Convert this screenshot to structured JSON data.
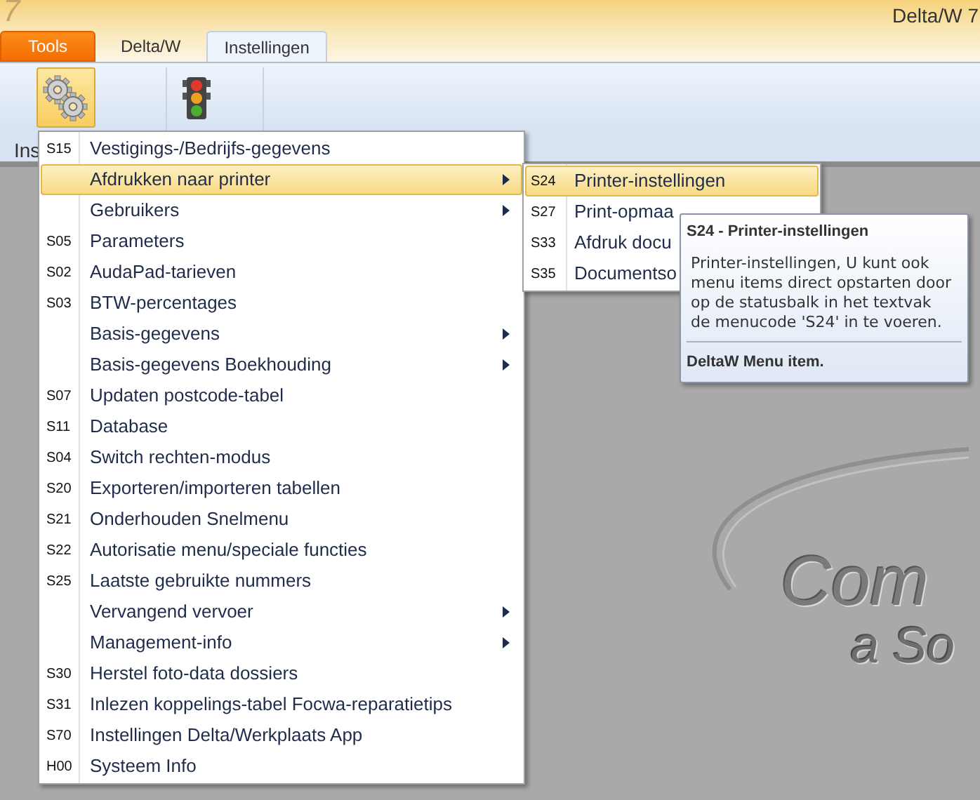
{
  "window": {
    "app_mark": "7",
    "title": "Delta/W 7"
  },
  "tabs": [
    {
      "label": "Tools",
      "selected": true
    },
    {
      "label": "Delta/W",
      "selected": false
    },
    {
      "label": "Instellingen",
      "selected": false
    }
  ],
  "ribbon": {
    "buttons": [
      {
        "kind": "gears",
        "selected": true
      },
      {
        "kind": "traffic-light",
        "selected": false
      }
    ],
    "group_label": "Ins"
  },
  "menu": {
    "items": [
      {
        "code": "S15",
        "label": "Vestigings-/Bedrijfs-gegevens",
        "submenu": false,
        "selected": false
      },
      {
        "label": "Afdrukken naar printer",
        "submenu": true,
        "selected": true
      },
      {
        "label": "Gebruikers",
        "submenu": true,
        "selected": false
      },
      {
        "code": "S05",
        "label": "Parameters",
        "submenu": false,
        "selected": false
      },
      {
        "code": "S02",
        "label": "AudaPad-tarieven",
        "submenu": false,
        "selected": false
      },
      {
        "code": "S03",
        "label": "BTW-percentages",
        "submenu": false,
        "selected": false
      },
      {
        "label": "Basis-gegevens",
        "submenu": true,
        "selected": false
      },
      {
        "label": "Basis-gegevens Boekhouding",
        "submenu": true,
        "selected": false
      },
      {
        "code": "S07",
        "label": "Updaten postcode-tabel",
        "submenu": false,
        "selected": false
      },
      {
        "code": "S11",
        "label": "Database",
        "submenu": false,
        "selected": false
      },
      {
        "code": "S04",
        "label": "Switch rechten-modus",
        "submenu": false,
        "selected": false
      },
      {
        "code": "S20",
        "label": "Exporteren/importeren tabellen",
        "submenu": false,
        "selected": false
      },
      {
        "code": "S21",
        "label": "Onderhouden Snelmenu",
        "submenu": false,
        "selected": false
      },
      {
        "code": "S22",
        "label": "Autorisatie menu/speciale functies",
        "submenu": false,
        "selected": false
      },
      {
        "code": "S25",
        "label": "Laatste gebruikte nummers",
        "submenu": false,
        "selected": false
      },
      {
        "label": "Vervangend vervoer",
        "submenu": true,
        "selected": false
      },
      {
        "label": "Management-info",
        "submenu": true,
        "selected": false
      },
      {
        "code": "S30",
        "label": "Herstel foto-data dossiers",
        "submenu": false,
        "selected": false
      },
      {
        "code": "S31",
        "label": "Inlezen koppelings-tabel Focwa-reparatietips",
        "submenu": false,
        "selected": false
      },
      {
        "code": "S70",
        "label": "Instellingen Delta/Werkplaats App",
        "submenu": false,
        "selected": false
      },
      {
        "code": "H00",
        "label": "Systeem Info",
        "submenu": false,
        "selected": false
      }
    ]
  },
  "submenu": {
    "items": [
      {
        "code": "S24",
        "label": "Printer-instellingen",
        "selected": true
      },
      {
        "code": "S27",
        "label": "Print-opmaa",
        "selected": false
      },
      {
        "code": "S33",
        "label": "Afdruk docu",
        "selected": false
      },
      {
        "code": "S35",
        "label": "Documentso",
        "selected": false
      }
    ]
  },
  "tooltip": {
    "title": "S24 - Printer-instellingen",
    "body": "Printer-instellingen, U kunt ook menu items direct opstarten door op de statusbalk in het textvak de menucode 'S24' in te voeren.",
    "footer": "DeltaW Menu item."
  },
  "background_logo": {
    "line_1": "Com",
    "line_2": "a So"
  }
}
